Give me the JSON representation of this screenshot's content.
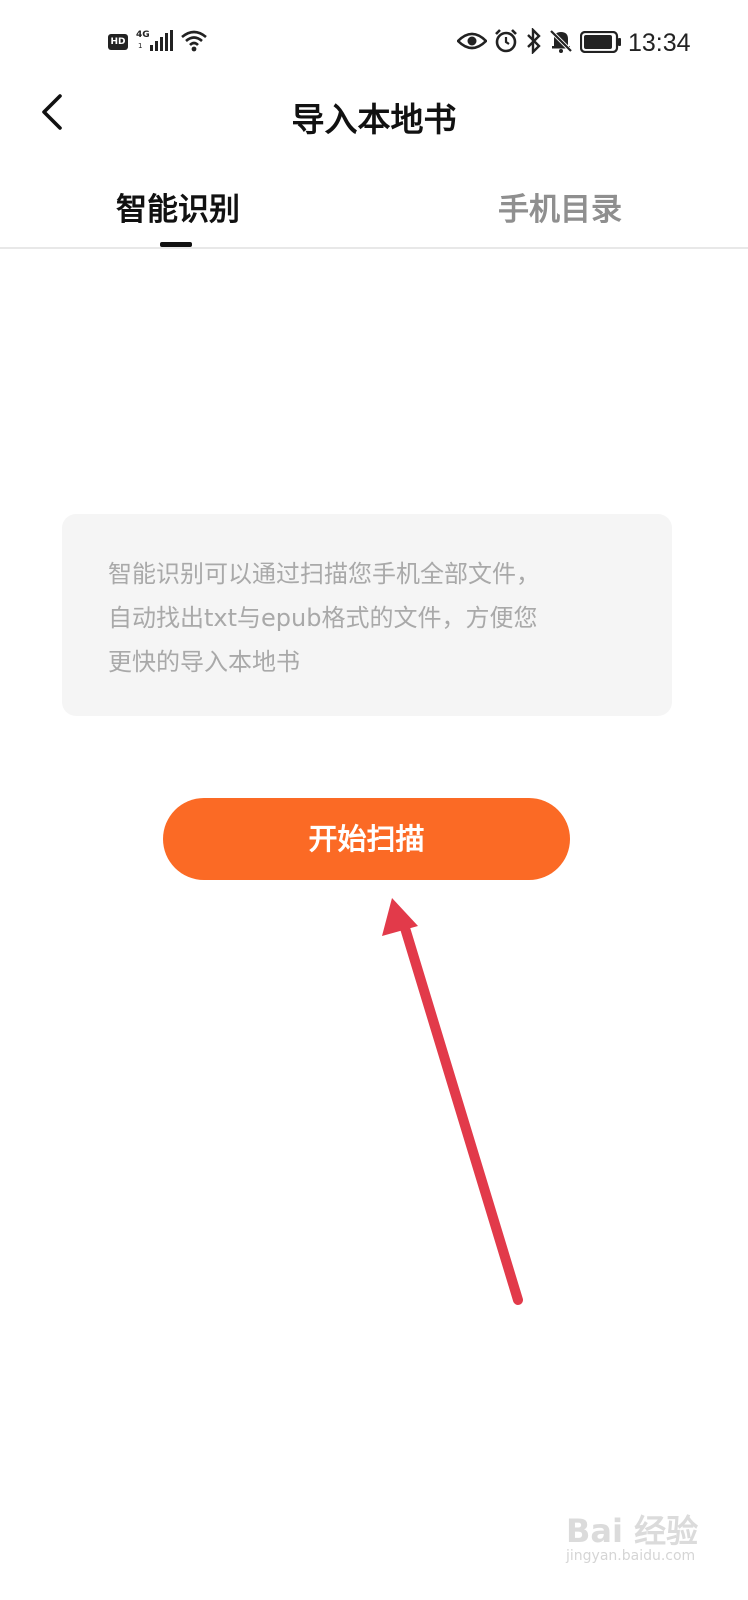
{
  "status_bar": {
    "hd_label": "HD",
    "network_label": "4G",
    "network_sub": "1",
    "time": "13:34",
    "icons": [
      "eye-icon",
      "alarm-icon",
      "bluetooth-icon",
      "mute-bell-icon",
      "battery-icon"
    ]
  },
  "header": {
    "title": "导入本地书",
    "back_icon": "back-chevron-icon"
  },
  "tabs": [
    {
      "label": "智能识别",
      "active": true
    },
    {
      "label": "手机目录",
      "active": false
    }
  ],
  "info_card": {
    "text": "智能识别可以通过扫描您手机全部文件，\n自动找出txt与epub格式的文件，方便您\n更快的导入本地书"
  },
  "scan_button": {
    "label": "开始扫描"
  },
  "annotation": {
    "arrow_color": "#e23a4a"
  },
  "watermark": {
    "text": "Bai 经验",
    "url": "jingyan.baidu.com"
  },
  "colors": {
    "accent": "#fb6a25",
    "text_primary": "#111111",
    "text_inactive": "#8f8f8f",
    "info_text": "#a9a9a9",
    "card_bg": "#f5f5f5"
  }
}
